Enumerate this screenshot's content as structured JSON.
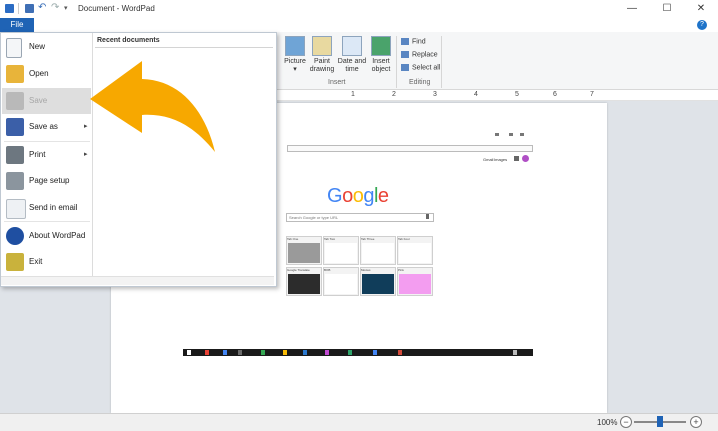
{
  "window": {
    "title": "Document - WordPad",
    "controls": {
      "minimize": "—",
      "maximize": "☐",
      "close": "✕"
    }
  },
  "ribbon": {
    "file_tab": "File",
    "help": "?",
    "insert_buttons": [
      {
        "label": "Picture",
        "caret": "▾"
      },
      {
        "label": "Paint drawing"
      },
      {
        "label": "Date and time"
      },
      {
        "label": "Insert object"
      }
    ],
    "insert_group_label": "Insert",
    "editing_buttons": [
      {
        "label": "Find"
      },
      {
        "label": "Replace"
      },
      {
        "label": "Select all"
      }
    ],
    "editing_group_label": "Editing"
  },
  "ruler": {
    "marks": [
      "1",
      "2",
      "3",
      "4",
      "5",
      "6",
      "7"
    ]
  },
  "file_menu": {
    "items": [
      {
        "label": "New"
      },
      {
        "label": "Open"
      },
      {
        "label": "Save"
      },
      {
        "label": "Save as",
        "arrow": "▸"
      },
      {
        "label": "Print",
        "arrow": "▸"
      },
      {
        "label": "Page setup"
      },
      {
        "label": "Send in email"
      },
      {
        "label": "About WordPad"
      },
      {
        "label": "Exit"
      }
    ],
    "recent_header": "Recent documents"
  },
  "embedded": {
    "logo_letters": [
      {
        "ch": "G",
        "color": "#4285f4"
      },
      {
        "ch": "o",
        "color": "#ea4335"
      },
      {
        "ch": "o",
        "color": "#fbbc05"
      },
      {
        "ch": "g",
        "color": "#4285f4"
      },
      {
        "ch": "l",
        "color": "#34a853"
      },
      {
        "ch": "e",
        "color": "#ea4335"
      }
    ],
    "search_placeholder": "Search Google or type URL",
    "top_links": [
      "Gmail",
      "Images"
    ],
    "tiles": [
      {
        "label": "Tab One",
        "color": "#9a9a9a"
      },
      {
        "label": "Tab Two",
        "color": "#ffffff"
      },
      {
        "label": "Tab Three",
        "color": "#ffffff"
      },
      {
        "label": "Tab Four",
        "color": "#ffffff"
      },
      {
        "label": "Google Translate",
        "color": "#2c2c2c"
      },
      {
        "label": "BOB",
        "color": "#ffffff"
      },
      {
        "label": "Movies",
        "color": "#103d5a"
      },
      {
        "label": "Pink",
        "color": "#f39df0"
      }
    ]
  },
  "status": {
    "zoom": "100%",
    "zoom_out": "−",
    "zoom_in": "+"
  },
  "colors": {
    "accent": "#1f63b5",
    "arrow": "#f7a800"
  }
}
